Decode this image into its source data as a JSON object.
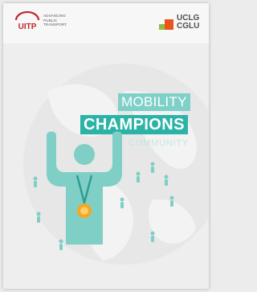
{
  "uitp": {
    "logo_text": "UITP",
    "tagline": [
      "ADVANCING",
      "PUBLIC",
      "TRANSPORT"
    ]
  },
  "uclg": {
    "line1": "UCLG",
    "line2": "CGLU"
  },
  "cover": {
    "title_line1": "MOBILITY",
    "title_line2": "CHAMPIONS",
    "title_line3": "COMMUNITY"
  },
  "colors": {
    "teal_dark": "#2bb3a6",
    "teal_light": "#7fd0c8",
    "medal": "#f5a623",
    "uclg_orange": "#e8531e",
    "uclg_green": "#8bbf3f",
    "uitp_red": "#c0272d"
  }
}
